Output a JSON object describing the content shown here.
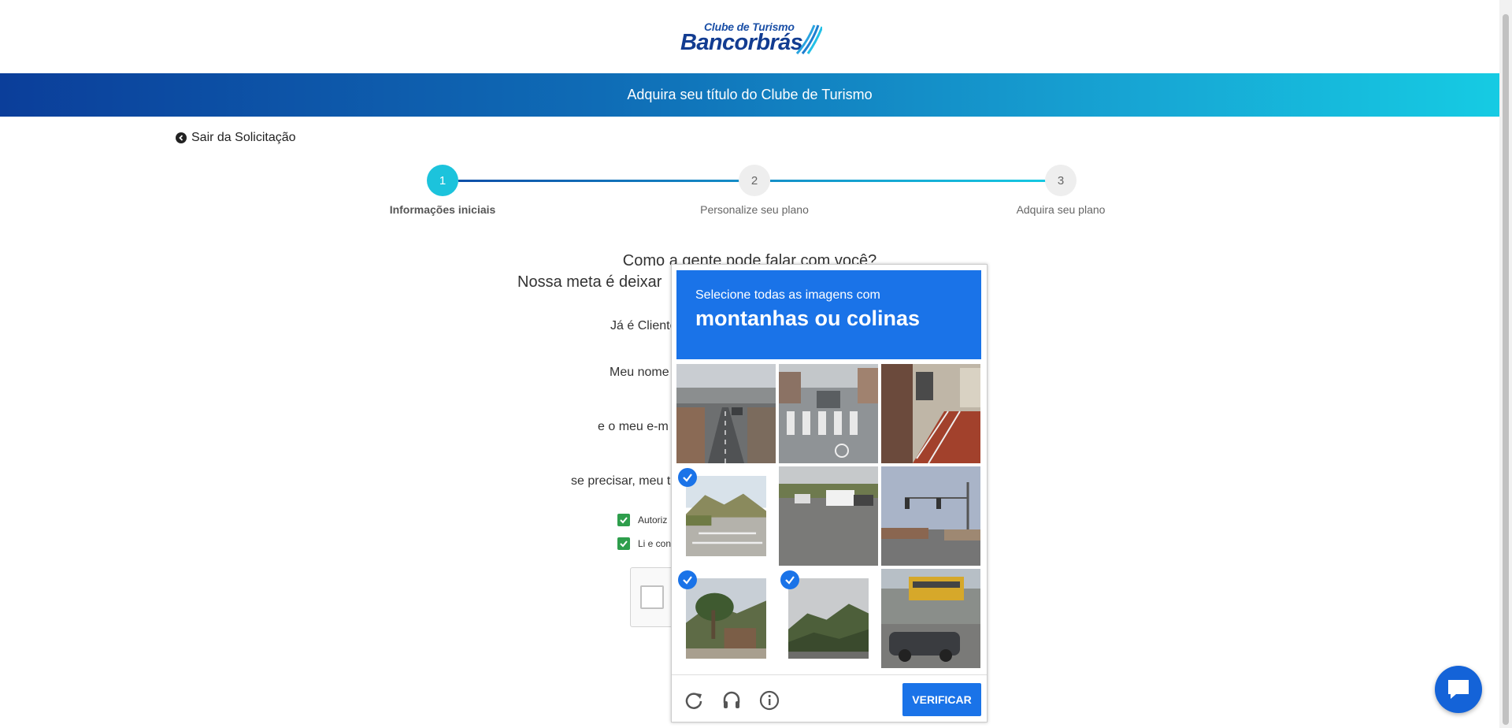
{
  "header": {
    "logo_line1": "Clube de Turismo",
    "logo_line2": "Bancorbrás",
    "banner_title": "Adquira seu título do Clube de Turismo"
  },
  "exit_link": "Sair da Solicitação",
  "stepper": {
    "steps": [
      {
        "number": "1",
        "label": "Informações iniciais",
        "active": true
      },
      {
        "number": "2",
        "label": "Personalize seu plano",
        "active": false
      },
      {
        "number": "3",
        "label": "Adquira seu plano",
        "active": false
      }
    ],
    "active_color": "#1cc3dc"
  },
  "form": {
    "heading1": "Como a gente pode falar com você?",
    "heading2": "Nossa meta é deixar",
    "client_label": "Já é Cliente",
    "name_label": "Meu nome",
    "email_label": "e o meu e-m",
    "phone_label": "se precisar, meu te",
    "consent1": "Autoriz",
    "consent2": "Li e con"
  },
  "captcha": {
    "instruction": "Selecione todas as imagens com",
    "target": "montanhas ou colinas",
    "tiles": [
      {
        "scene": "overpass-road",
        "selected": false
      },
      {
        "scene": "crosswalk-street",
        "selected": false
      },
      {
        "scene": "house-stairs",
        "selected": false
      },
      {
        "scene": "desert-intersection",
        "selected": true
      },
      {
        "scene": "parking-lot",
        "selected": false
      },
      {
        "scene": "traffic-lights",
        "selected": false
      },
      {
        "scene": "palm-house",
        "selected": true
      },
      {
        "scene": "green-hills",
        "selected": true
      },
      {
        "scene": "school-bus-car",
        "selected": false
      }
    ],
    "verify_label": "VERIFICAR",
    "accent": "#1a73e8"
  }
}
